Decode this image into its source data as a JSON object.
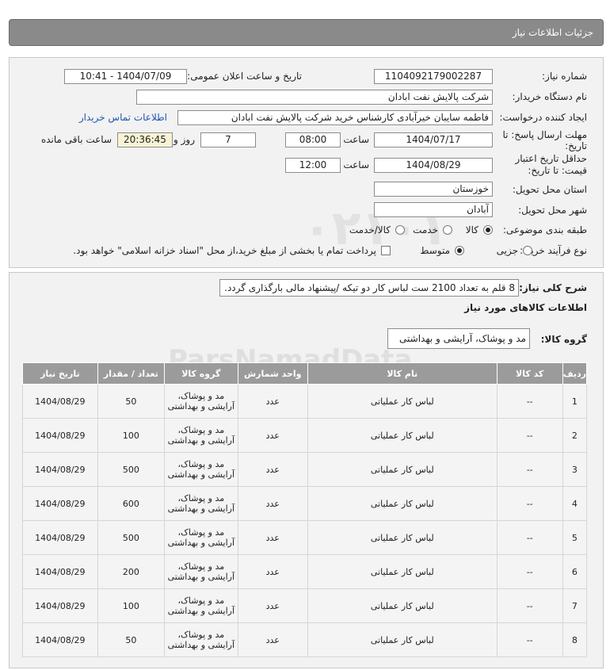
{
  "header": {
    "title": "جزئیات اطلاعات نیاز"
  },
  "form": {
    "need_number_label": "شماره نیاز:",
    "need_number": "1104092179002287",
    "announce_label": "تاریخ و ساعت اعلان عمومی:",
    "announce_value": "1404/07/09 - 10:41",
    "buyer_label": "نام دستگاه خریدار:",
    "buyer_value": "شرکت پالایش نفت ابادان",
    "creator_label": "ایجاد کننده درخواست:",
    "creator_value": "فاطمه سایبان خیرآبادی کارشناس خرید شرکت پالایش نفت ابادان",
    "contact_link": "اطلاعات تماس خریدار",
    "deadline_label_1": "مهلت ارسال پاسخ: تا",
    "deadline_label_2": "تاریخ:",
    "deadline_date": "1404/07/17",
    "time_label": "ساعت",
    "deadline_time": "08:00",
    "days_value": "7",
    "days_label": "روز و",
    "remaining_time": "20:36:45",
    "remaining_label": "ساعت باقی مانده",
    "validity_label_1": "حداقل تاریخ اعتبار",
    "validity_label_2": "قیمت: تا تاریخ:",
    "validity_date": "1404/08/29",
    "validity_time": "12:00",
    "province_label": "استان محل تحویل:",
    "province_value": "خوزستان",
    "city_label": "شهر محل تحویل:",
    "city_value": "آبادان",
    "category_label": "طبقه بندی موضوعی:",
    "category_options": [
      "کالا",
      "خدمت",
      "کالا/خدمت"
    ],
    "category_selected": "کالا",
    "process_label": "نوع فرآیند خرید :",
    "process_options": [
      "جزیی",
      "متوسط"
    ],
    "process_selected": "متوسط",
    "payment_note": "پرداخت تمام یا بخشی از مبلغ خرید،از محل \"اسناد خزانه اسلامی\" خواهد بود."
  },
  "description": {
    "label": "شرح کلی نیاز:",
    "text": "8 قلم به تعداد 2100 ست لباس کار دو تیکه /پیشنهاد مالی بارگذاری گردد.",
    "goods_info_title": "اطلاعات کالاهای مورد نیاز",
    "group_label": "گروه کالا:",
    "group_value": "مد و پوشاک، آرایشی و بهداشتی"
  },
  "table": {
    "headers": [
      "ردیف",
      "کد کالا",
      "نام کالا",
      "واحد شمارش",
      "گروه کالا",
      "تعداد / مقدار",
      "تاریخ نیاز"
    ],
    "rows": [
      {
        "idx": "1",
        "code": "--",
        "name": "لباس کار عملیاتی",
        "unit": "عدد",
        "group": "مد و پوشاک، آرایشی و بهداشتی",
        "qty": "50",
        "date": "1404/08/29"
      },
      {
        "idx": "2",
        "code": "--",
        "name": "لباس کار عملیاتی",
        "unit": "عدد",
        "group": "مد و پوشاک، آرایشی و بهداشتی",
        "qty": "100",
        "date": "1404/08/29"
      },
      {
        "idx": "3",
        "code": "--",
        "name": "لباس کار عملیاتی",
        "unit": "عدد",
        "group": "مد و پوشاک، آرایشی و بهداشتی",
        "qty": "500",
        "date": "1404/08/29"
      },
      {
        "idx": "4",
        "code": "--",
        "name": "لباس کار عملیاتی",
        "unit": "عدد",
        "group": "مد و پوشاک، آرایشی و بهداشتی",
        "qty": "600",
        "date": "1404/08/29"
      },
      {
        "idx": "5",
        "code": "--",
        "name": "لباس کار عملیاتی",
        "unit": "عدد",
        "group": "مد و پوشاک، آرایشی و بهداشتی",
        "qty": "500",
        "date": "1404/08/29"
      },
      {
        "idx": "6",
        "code": "--",
        "name": "لباس کار عملیاتی",
        "unit": "عدد",
        "group": "مد و پوشاک، آرایشی و بهداشتی",
        "qty": "200",
        "date": "1404/08/29"
      },
      {
        "idx": "7",
        "code": "--",
        "name": "لباس کار عملیاتی",
        "unit": "عدد",
        "group": "مد و پوشاک، آرایشی و بهداشتی",
        "qty": "100",
        "date": "1404/08/29"
      },
      {
        "idx": "8",
        "code": "--",
        "name": "لباس کار عملیاتی",
        "unit": "عدد",
        "group": "مد و پوشاک، آرایشی و بهداشتی",
        "qty": "50",
        "date": "1404/08/29"
      }
    ]
  },
  "watermark": {
    "brand": "ParsNamadData",
    "line1": "مرکز فراوری اطلاعات پارس نماد داده",
    "line2": "پایگاه اطلاع رسانی مناقصه و مزایده",
    "phone": "۰۲۱-۸۸۳۴۹۶۷۰-۵"
  }
}
